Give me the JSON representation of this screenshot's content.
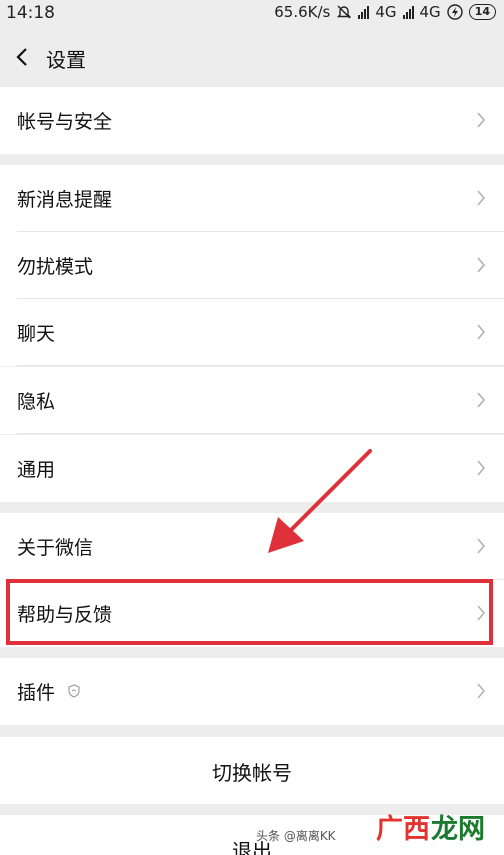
{
  "status_bar": {
    "time": "14:18",
    "speed": "65.6K/s",
    "network1": "4G",
    "network2": "4G",
    "battery": "14"
  },
  "nav": {
    "title": "设置"
  },
  "rows": {
    "account_security": "帐号与安全",
    "new_message": "新消息提醒",
    "dnd": "勿扰模式",
    "chat": "聊天",
    "privacy": "隐私",
    "general": "通用",
    "about": "关于微信",
    "help_feedback": "帮助与反馈",
    "plugins": "插件",
    "switch_account": "切换帐号",
    "logout": "退出"
  },
  "watermark": {
    "small": "头条 @离离KK",
    "logo_a": "广西",
    "logo_b": "龙网"
  },
  "colors": {
    "highlight": "#e0313a",
    "background": "#ededed"
  }
}
